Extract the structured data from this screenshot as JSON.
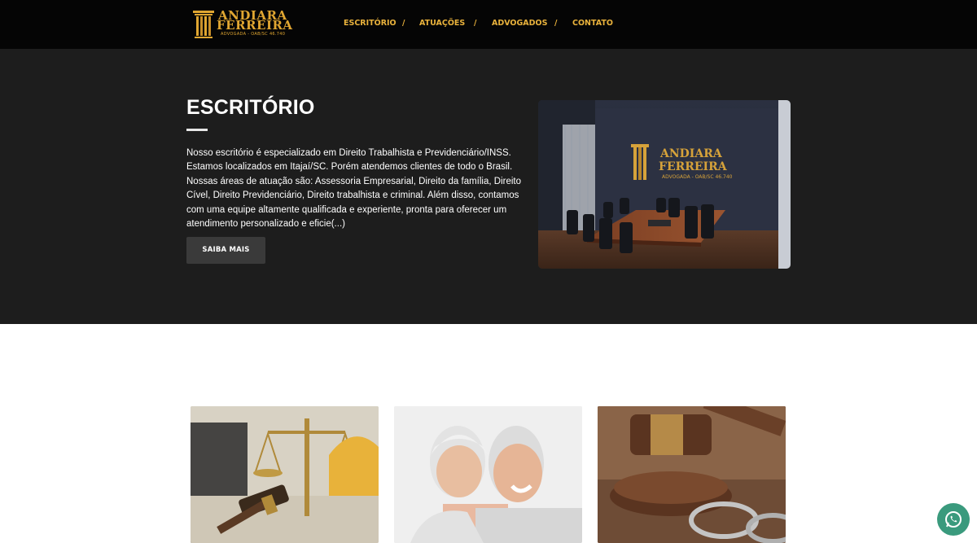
{
  "header": {
    "logo": {
      "name_line1": "ANDIARA",
      "name_line2": "FERREIRA",
      "subtitle": "ADVOGADA - OAB/SC 46.740"
    },
    "nav": {
      "items": [
        {
          "label": "ESCRITÓRIO"
        },
        {
          "label": "ATUAÇÕES"
        },
        {
          "label": "ADVOGADOS"
        },
        {
          "label": "CONTATO"
        }
      ],
      "separator": "/"
    }
  },
  "hero": {
    "title": "ESCRITÓRIO",
    "paragraph_lines": [
      "Nosso escritório é especializado em Direito Trabalhista e Previdenciário/INSS.",
      "Estamos localizados em Itajaí/SC. Porém atendemos clientes de todo o Brasil.",
      "Nossas áreas de atuação são: Assessoria Empresarial, Direito da família, Direito",
      "Cível, Direito Previdenciário, Direito trabalhista e criminal. Além disso, contamos",
      "com uma equipe altamente qualificada e experiente, pronta para oferecer um",
      "atendimento personalizado e eficie(...)"
    ],
    "button_label": "SAIBA MAIS",
    "office_image": {
      "sign_line1": "ANDIARA",
      "sign_line2": "FERREIRA",
      "sign_sub": "ADVOGADA - OAB/SC 46.740"
    }
  },
  "cards": [
    {
      "image": "scales-of-justice-gavel"
    },
    {
      "image": "elderly-couple-smiling"
    },
    {
      "image": "gavel-and-handcuffs"
    }
  ],
  "floating": {
    "icon": "whatsapp-icon"
  },
  "colors": {
    "header_bg": "#050505",
    "accent_gold": "#e0a631",
    "hero_bg": "#1d1d1d",
    "button_bg": "#3a3a3a",
    "whatsapp_green": "#3a9a7d"
  }
}
